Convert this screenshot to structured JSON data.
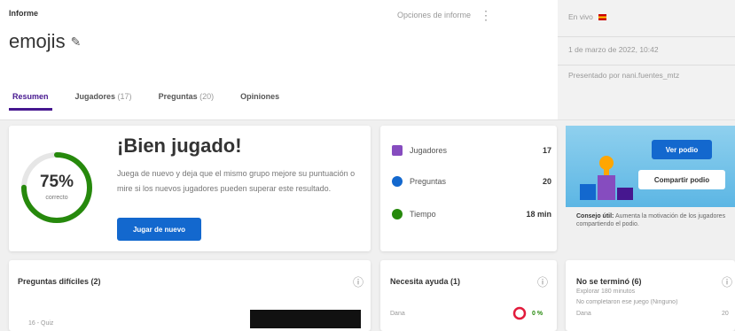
{
  "breadcrumb": "Informe",
  "title": "emojis",
  "report_options": "Opciones de informe",
  "right_panel": {
    "mode": "En vivo",
    "date": "1 de marzo de 2022, 10:42",
    "host": "Presentado por nani.fuentes_mtz"
  },
  "tabs": [
    {
      "label": "Resumen",
      "count": ""
    },
    {
      "label": "Jugadores",
      "count": "(17)"
    },
    {
      "label": "Preguntas",
      "count": "(20)"
    },
    {
      "label": "Opiniones",
      "count": ""
    }
  ],
  "summary": {
    "percent": "75%",
    "percent_value": 0.75,
    "percent_sub": "correcto",
    "heading": "¡Bien jugado!",
    "description": "Juega de nuevo y deja que el mismo grupo mejore su puntuación o mire si los nuevos jugadores pueden superar este resultado.",
    "button": "Jugar de nuevo"
  },
  "stats": [
    {
      "label": "Jugadores",
      "value": "17",
      "icon": "person-icon",
      "color": "#864cbf"
    },
    {
      "label": "Preguntas",
      "value": "20",
      "icon": "question-icon",
      "color": "#1368ce"
    },
    {
      "label": "Tiempo",
      "value": "18 min",
      "icon": "clock-icon",
      "color": "#26890c"
    }
  ],
  "promo": {
    "view_podium": "Ver podio",
    "share_podium": "Compartir podio",
    "text_bold": "Consejo útil:",
    "text": "Aumenta la motivación de los jugadores compartiendo el podio."
  },
  "sections": {
    "difficult": "Preguntas difíciles (2)",
    "difficult_item": "16 - Quiz",
    "help": "Necesita ayuda (1)",
    "help_item": "Dana",
    "help_pct": "0 %",
    "unfinished": "No se terminó (6)",
    "unfinished_note": "Explorar 180 minutos",
    "unfinished_sub": "No completaron ese juego (Ninguno)",
    "unfinished_item": "Dana",
    "unfinished_val": "20"
  },
  "colors": {
    "accent": "#46178f",
    "primary_blue": "#1368ce",
    "ring_green": "#26890c"
  }
}
